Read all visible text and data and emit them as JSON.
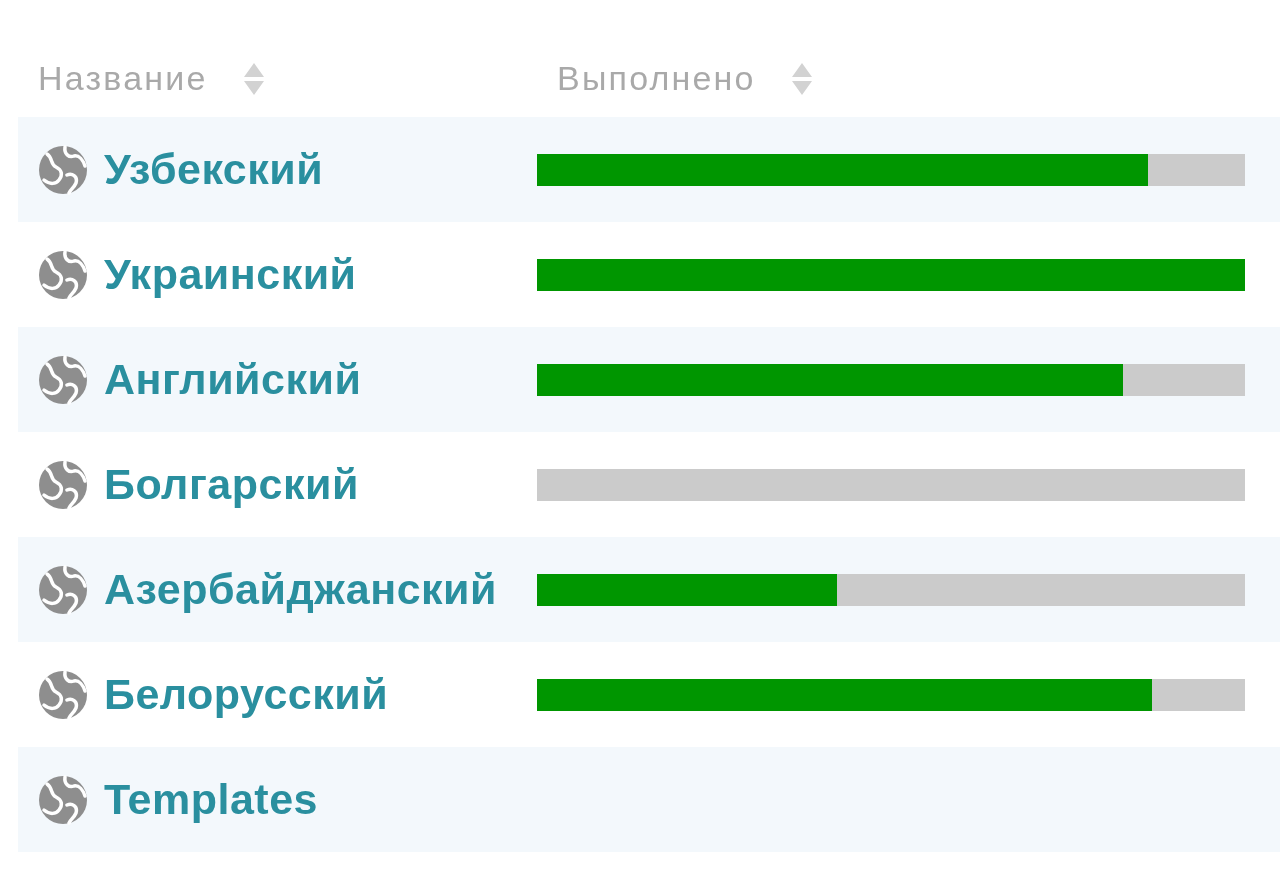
{
  "table": {
    "columns": [
      {
        "label": "Название"
      },
      {
        "label": "Выполнено"
      }
    ],
    "rows": [
      {
        "name": "Узбекский",
        "level": 0.863
      },
      {
        "name": "Украинский",
        "level": 1
      },
      {
        "name": "Английский",
        "level": 0.828
      },
      {
        "name": "Болгарский",
        "level": 0
      },
      {
        "name": "Азербайджанский",
        "level": 0.424
      },
      {
        "name": "Белорусский",
        "level": 0.869
      },
      {
        "name": "Templates"
      }
    ]
  }
}
